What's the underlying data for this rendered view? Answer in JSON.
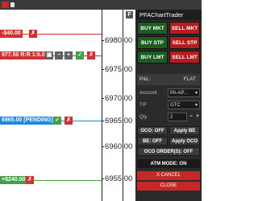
{
  "window": {
    "panel_title": "PFAChartTrader"
  },
  "chart": {
    "price_labels": [
      "6980.00",
      "6975.00",
      "6970.00",
      "6965.00",
      "6960.00",
      "6955.00"
    ],
    "f_button": "F",
    "orders": [
      {
        "text": "-$40.00",
        "color": "#d32f2f"
      },
      {
        "text": "977.50 R:R 1:6.00",
        "color": "#d32f2f"
      },
      {
        "text": "6965.00 [PENDING]",
        "color": "#1e88e5"
      },
      {
        "text": "+$240.00",
        "color": "#43a047"
      }
    ],
    "icons": {
      "cancel": "✗",
      "check": "✓",
      "minus": "−",
      "plus": "+",
      "lock": "🔒"
    }
  },
  "panel": {
    "buy_mkt": "BUY MKT",
    "sell_mkt": "SELL MKT",
    "buy_stp": "BUY STP",
    "sell_stp": "SELL STP",
    "buy_lmt": "BUY LMT",
    "sell_lmt": "SELL LMT",
    "pl_label": "P&L:",
    "pl_value": "FLAT",
    "account_label": "Account",
    "account_value": "PA-AP...",
    "tif_label": "TIF",
    "tif_value": "GTC",
    "qty_label": "Qty",
    "qty_value": "2",
    "oco_off": "OCO: OFF",
    "apply_be": "Apply BE",
    "be_off": "BE: OFF",
    "apply_oco": "Apply OCO",
    "oco_orders": "OCO ORDER(S): OFF",
    "atm_mode": "ATM MODE: ON",
    "x_cancel": "X CANCEL",
    "close": "CLOSE"
  }
}
